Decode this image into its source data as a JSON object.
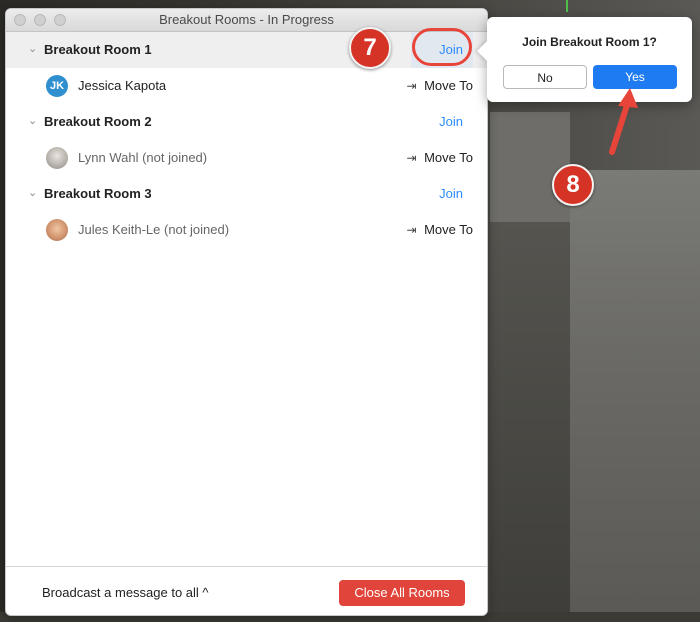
{
  "window": {
    "title": "Breakout Rooms - In Progress"
  },
  "rooms": [
    {
      "name": "Breakout Room 1",
      "join_label": "Join",
      "participants": [
        {
          "name": "Jessica Kapota",
          "initials": "JK",
          "move_label": "Move To"
        }
      ]
    },
    {
      "name": "Breakout Room 2",
      "join_label": "Join",
      "participants": [
        {
          "name": "Lynn Wahl (not joined)",
          "move_label": "Move To"
        }
      ]
    },
    {
      "name": "Breakout Room 3",
      "join_label": "Join",
      "participants": [
        {
          "name": "Jules Keith-Le (not joined)",
          "move_label": "Move To"
        }
      ]
    }
  ],
  "footer": {
    "broadcast_label": "Broadcast a message to all ^",
    "close_all_label": "Close All Rooms"
  },
  "popover": {
    "title": "Join Breakout Room 1?",
    "no_label": "No",
    "yes_label": "Yes"
  },
  "annotations": {
    "step_7": "7",
    "step_8": "8"
  },
  "colors": {
    "link": "#2d8cff",
    "danger": "#e0443a",
    "primary": "#1f7bf2",
    "annotation": "#d63327"
  }
}
